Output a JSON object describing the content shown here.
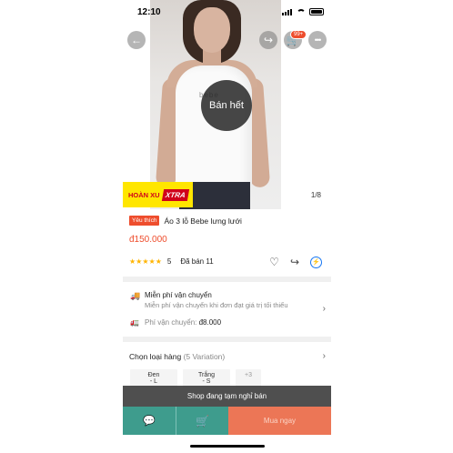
{
  "status_bar": {
    "time": "12:10"
  },
  "header": {
    "cart_badge": "99+"
  },
  "image": {
    "soldout_label": "Bán hết",
    "pager": "1/8",
    "brand_print": "bebe"
  },
  "promo": {
    "label": "HOÀN XU",
    "highlight": "XTRA",
    "colors": {
      "bg": "#ffe600",
      "accent": "#d0021b"
    }
  },
  "product": {
    "favorite_tag": "Yêu thích",
    "title": "Áo 3 lỗ Bebe lưng lưới",
    "price": "đ150.000",
    "stars": "★★★★★",
    "rating": "5",
    "sold": "Đã bán 11"
  },
  "shipping": {
    "title": "Miễn phí vận chuyển",
    "subtitle": "Miễn phí vận chuyển khi đơn đạt giá trị tối thiểu",
    "fee_label": "Phí vận chuyển:",
    "fee_value": "đ8.000"
  },
  "variation": {
    "label": "Chọn loại hàng",
    "count": "(5 Variation)",
    "options": [
      {
        "line1": "Đen",
        "line2": "- L"
      },
      {
        "line1": "Trắng",
        "line2": "- S"
      },
      {
        "line1": "+3",
        "line2": ""
      }
    ]
  },
  "notice": {
    "shop_closed": "Shop đang tạm nghỉ bán"
  },
  "bottom_bar": {
    "buy_now": "Mua ngay"
  },
  "colors": {
    "brand": "#ee4d2d",
    "chat_bar": "#3e9c8d",
    "buy_bar": "#ec7656"
  }
}
